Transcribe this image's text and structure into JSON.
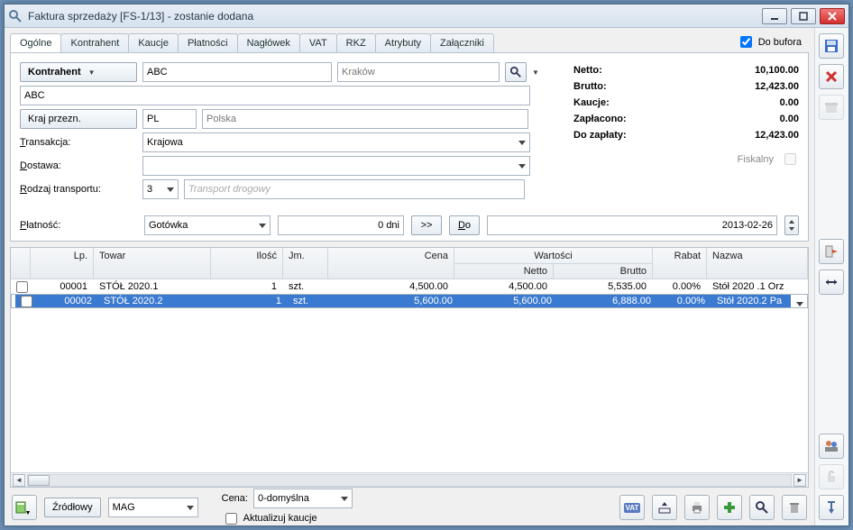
{
  "window": {
    "title": "Faktura sprzedaży [FS-1/13]  - zostanie dodana"
  },
  "tabs": [
    "Ogólne",
    "Kontrahent",
    "Kaucje",
    "Płatności",
    "Nagłówek",
    "VAT",
    "RKZ",
    "Atrybuty",
    "Załączniki"
  ],
  "bufor": {
    "label": "Do bufora",
    "checked": true
  },
  "kontrahent_btn": "Kontrahent",
  "kontrahent_code": "ABC",
  "kontrahent_city": "Kraków",
  "kontrahent_name": "ABC",
  "kraj_btn": "Kraj przezn.",
  "kraj_code": "PL",
  "kraj_name": "Polska",
  "labels": {
    "transakcja": "Transakcja:",
    "dostawa": "Dostawa:",
    "rodzaj_transportu": "Rodzaj transportu:",
    "platnosc": "Płatność:",
    "cena": "Cena:",
    "aktualizuj": "Aktualizuj kaucje",
    "zrodlowy": "Źródłowy",
    "do": "Do",
    "dni": "0 dni",
    "fiskalny": "Fiskalny"
  },
  "transakcja_value": "Krajowa",
  "dostawa_value": "",
  "transport_code": "3",
  "transport_desc": "Transport drogowy",
  "platnosc_value": "Gotówka",
  "platnosc_date": "2013-02-26",
  "mag_value": "MAG",
  "cena_select": "0-domyślna",
  "totals": {
    "netto_k": "Netto:",
    "netto_v": "10,100.00",
    "brutto_k": "Brutto:",
    "brutto_v": "12,423.00",
    "kaucje_k": "Kaucje:",
    "kaucje_v": "0.00",
    "zaplacono_k": "Zapłacono:",
    "zaplacono_v": "0.00",
    "dozaplaty_k": "Do zapłaty:",
    "dozaplaty_v": "12,423.00"
  },
  "grid": {
    "headers": {
      "lp": "Lp.",
      "towar": "Towar",
      "ilosc": "Ilość",
      "jm": "Jm.",
      "cena": "Cena",
      "wartosci": "Wartości",
      "netto": "Netto",
      "brutto": "Brutto",
      "rabat": "Rabat",
      "nazwa": "Nazwa"
    },
    "rows": [
      {
        "lp": "00001",
        "towar": "STÓŁ 2020.1",
        "ilosc": "1",
        "jm": "szt.",
        "cena": "4,500.00",
        "netto": "4,500.00",
        "brutto": "5,535.00",
        "rabat": "0.00%",
        "nazwa": "Stół 2020 .1 Orz"
      },
      {
        "lp": "00002",
        "towar": "STÓŁ 2020.2",
        "ilosc": "1",
        "jm": "szt.",
        "cena": "5,600.00",
        "netto": "5,600.00",
        "brutto": "6,888.00",
        "rabat": "0.00%",
        "nazwa": "Stół 2020.2 Pa"
      }
    ]
  }
}
